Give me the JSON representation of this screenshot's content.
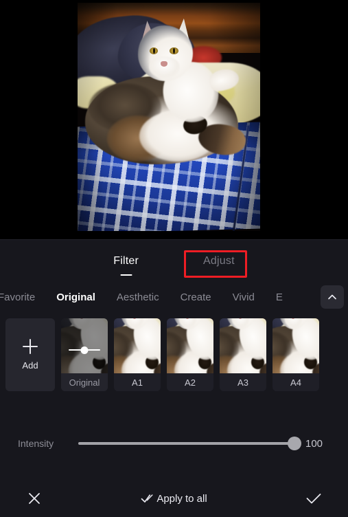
{
  "preview": {
    "photo_alt": "cat lying on blue plaid blanket with pillows"
  },
  "mode_tabs": {
    "filter_label": "Filter",
    "adjust_label": "Adjust",
    "active": "Filter",
    "focus_highlight_color": "#ee1d24",
    "focused_tab": "Adjust"
  },
  "categories": {
    "items": [
      {
        "label": "Favorite",
        "active": false
      },
      {
        "label": "Original",
        "active": true
      },
      {
        "label": "Aesthetic",
        "active": false
      },
      {
        "label": "Create",
        "active": false
      },
      {
        "label": "Vivid",
        "active": false
      },
      {
        "label": "E",
        "active": false
      }
    ],
    "expand_icon": "chevron-up-icon"
  },
  "filters": {
    "add_label": "Add",
    "add_icon": "plus-icon",
    "items": [
      {
        "label": "Original",
        "selected": true,
        "has_mini_slider": true
      },
      {
        "label": "A1",
        "selected": false,
        "has_mini_slider": false
      },
      {
        "label": "A2",
        "selected": false,
        "has_mini_slider": false
      },
      {
        "label": "A3",
        "selected": false,
        "has_mini_slider": false
      },
      {
        "label": "A4",
        "selected": false,
        "has_mini_slider": false
      }
    ]
  },
  "intensity": {
    "label": "Intensity",
    "value": "100",
    "percent": 100,
    "min": 0,
    "max": 100
  },
  "bottom_bar": {
    "cancel_icon": "close-icon",
    "apply_all_icon": "double-check-icon",
    "apply_all_label": "Apply to all",
    "confirm_icon": "check-icon"
  }
}
